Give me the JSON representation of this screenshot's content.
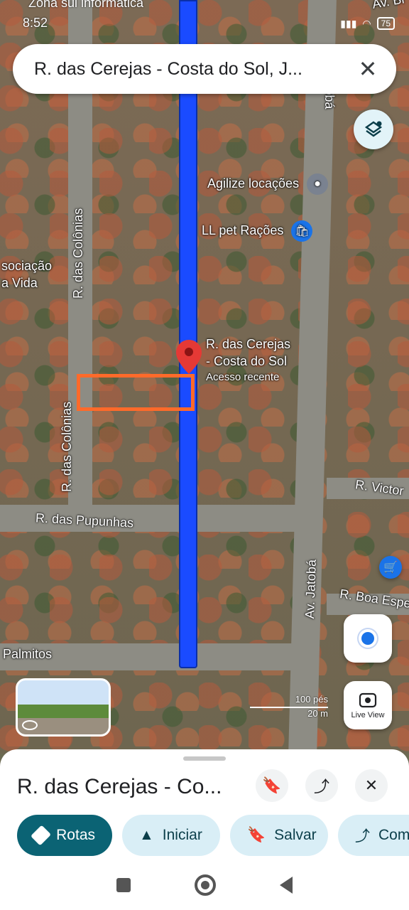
{
  "status_bar": {
    "time": "8:52",
    "carrier_overlay": "Zona sul informática",
    "battery": "75"
  },
  "search": {
    "value": "R. das Cerejas - Costa do Sol, J..."
  },
  "map": {
    "street_labels": {
      "colonias_top": "R. das Colônias",
      "colonias_bottom": "R. das Colônias",
      "pupunhas": "R. das Pupunhas",
      "palmitos": "Palmitos",
      "jatoba_top": "Av. Jatobá",
      "jatoba_bottom": "Av. Jatobá",
      "victor": "R. Victor",
      "boa_esp": "R. Boa Espe",
      "av_br": "Av. Br"
    },
    "poi": {
      "agilize": "Agilize locações",
      "llpet": "LL pet Rações",
      "associacao_1": "sociação",
      "associacao_2": "a Vida"
    },
    "pin": {
      "line1": "R. das Cerejas",
      "line2": "- Costa do Sol",
      "line3": "Acesso recente"
    },
    "scale": {
      "feet": "100 pés",
      "meters": "20 m"
    },
    "live_view_label": "Live View"
  },
  "sheet": {
    "title": "R. das Cerejas - Co...",
    "actions": {
      "rotas": "Rotas",
      "iniciar": "Iniciar",
      "salvar": "Salvar",
      "compartilhar": "Com"
    }
  },
  "colors": {
    "route": "#1a4bff",
    "pin": "#e53935",
    "primary_chip": "#0b6374",
    "secondary_chip": "#d9eef6",
    "highlight": "#ff6a2a"
  }
}
